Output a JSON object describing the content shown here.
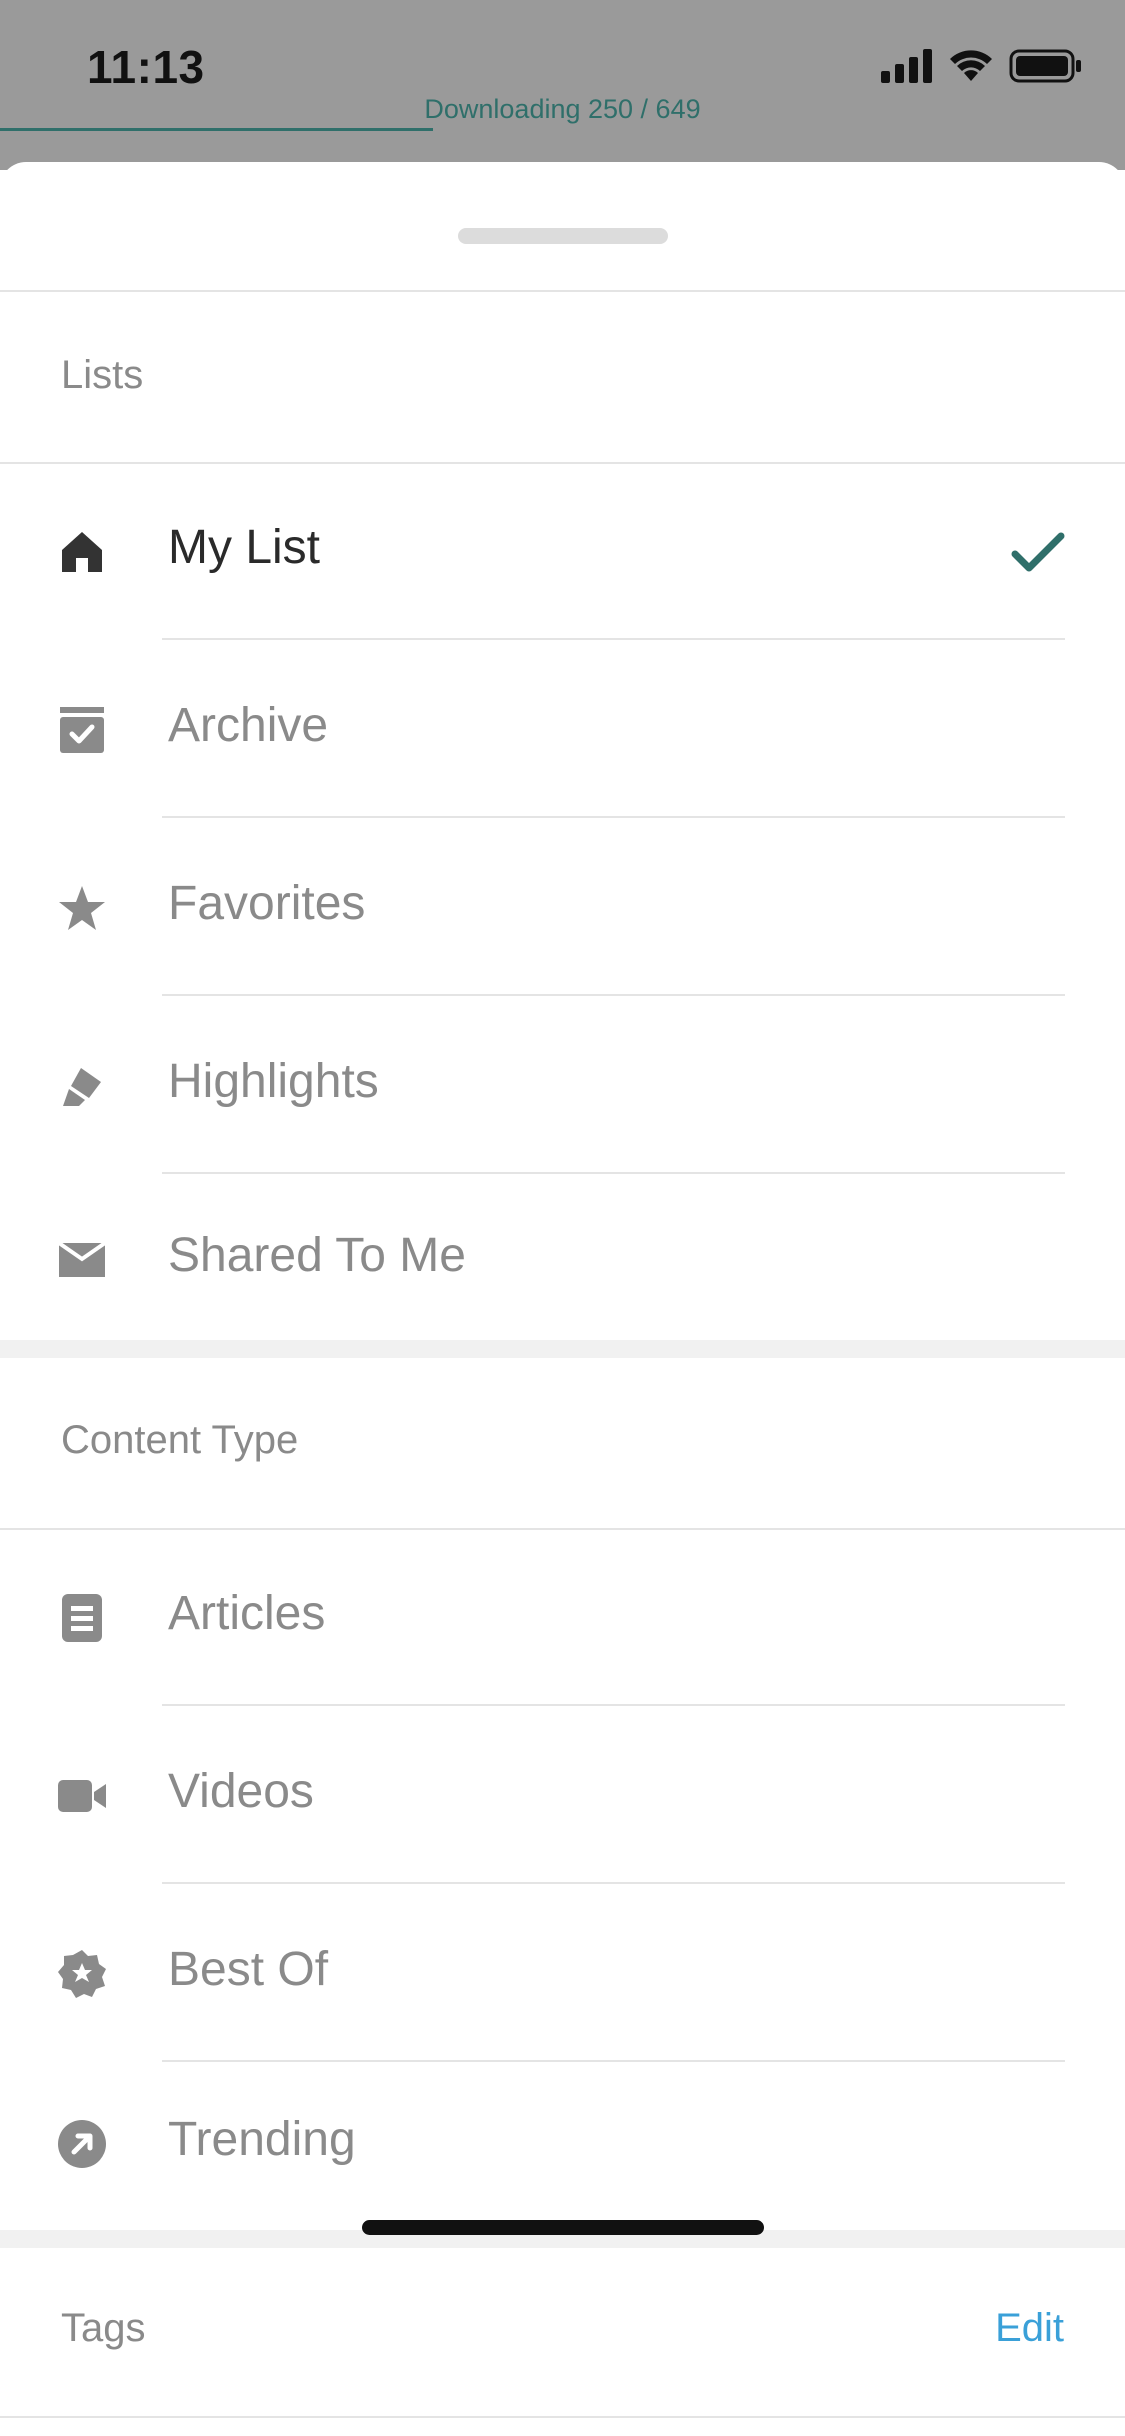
{
  "status_bar": {
    "time": "11:13"
  },
  "download": {
    "text": "Downloading 250 / 649",
    "progress": 0.385
  },
  "sections": {
    "lists": {
      "title": "Lists",
      "items": [
        {
          "label": "My List",
          "icon": "home-icon",
          "selected": true
        },
        {
          "label": "Archive",
          "icon": "archive-icon"
        },
        {
          "label": "Favorites",
          "icon": "star-icon"
        },
        {
          "label": "Highlights",
          "icon": "highlighter-icon"
        },
        {
          "label": "Shared To Me",
          "icon": "envelope-icon"
        }
      ]
    },
    "content_type": {
      "title": "Content Type",
      "items": [
        {
          "label": "Articles",
          "icon": "article-icon"
        },
        {
          "label": "Videos",
          "icon": "video-icon"
        },
        {
          "label": "Best Of",
          "icon": "badge-star-icon"
        },
        {
          "label": "Trending",
          "icon": "trending-arrow-icon"
        }
      ]
    },
    "tags": {
      "title": "Tags",
      "edit_label": "Edit"
    }
  },
  "colors": {
    "accent": "#2f6f6a",
    "link": "#3aa0d8",
    "icon": "#8a8a8a"
  }
}
